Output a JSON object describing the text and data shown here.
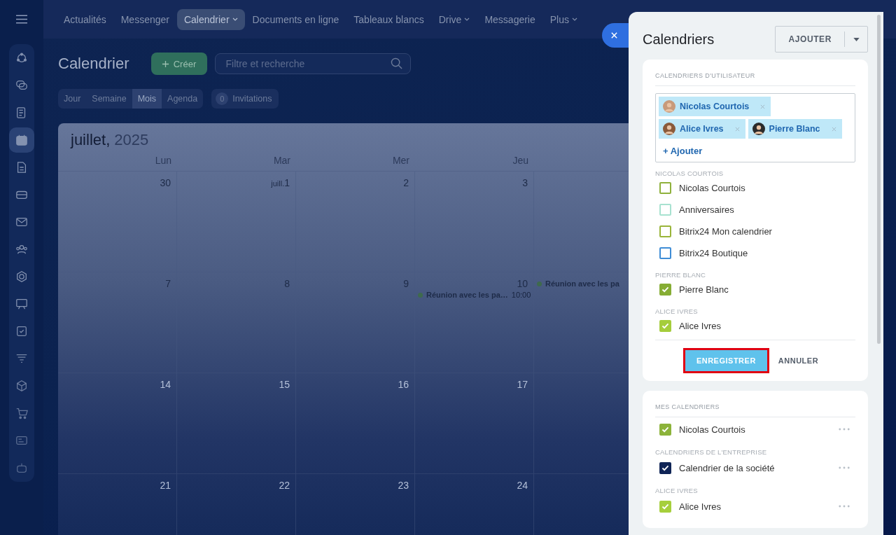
{
  "nav": {
    "items": [
      {
        "label": "Actualités",
        "selected": false,
        "dropdown": false
      },
      {
        "label": "Messenger",
        "selected": false,
        "dropdown": false
      },
      {
        "label": "Calendrier",
        "selected": true,
        "dropdown": true
      },
      {
        "label": "Documents en ligne",
        "selected": false,
        "dropdown": false
      },
      {
        "label": "Tableaux blancs",
        "selected": false,
        "dropdown": false
      },
      {
        "label": "Drive",
        "selected": false,
        "dropdown": true
      },
      {
        "label": "Messagerie",
        "selected": false,
        "dropdown": false
      },
      {
        "label": "Plus",
        "selected": false,
        "dropdown": true
      }
    ]
  },
  "sidebar": {
    "items": [
      {
        "selected": false
      },
      {
        "selected": false
      },
      {
        "selected": false
      },
      {
        "selected": true
      },
      {
        "selected": false
      },
      {
        "selected": false
      },
      {
        "selected": false
      },
      {
        "selected": false
      },
      {
        "selected": false
      },
      {
        "selected": false
      },
      {
        "selected": false
      },
      {
        "selected": false
      },
      {
        "selected": false
      },
      {
        "selected": false
      },
      {
        "selected": false
      },
      {
        "selected": false
      }
    ]
  },
  "header": {
    "title": "Calendrier",
    "create_button": "Créer",
    "search": {
      "placeholder": "Filtre et recherche"
    }
  },
  "views": [
    {
      "label": "Jour",
      "selected": false
    },
    {
      "label": "Semaine",
      "selected": false
    },
    {
      "label": "Mois",
      "selected": true
    },
    {
      "label": "Agenda",
      "selected": false
    }
  ],
  "invitations": {
    "count": "0",
    "label": "Invitations"
  },
  "calendar": {
    "month": "juillet,",
    "year": "2025",
    "weekdays": [
      "Lun",
      "Mar",
      "Mer",
      "Jeu"
    ],
    "weeks": [
      {
        "days": [
          {
            "label": "30"
          },
          {
            "prefix": "juill.",
            "label": "1"
          },
          {
            "label": "2"
          },
          {
            "label": "3"
          }
        ]
      },
      {
        "days": [
          {
            "label": "7"
          },
          {
            "label": "8"
          },
          {
            "label": "9"
          },
          {
            "label": "10",
            "events": [
              {
                "title": "Réunion avec les pa…",
                "time": "10:00"
              }
            ]
          },
          {
            "events": [
              {
                "title": "Réunion avec les pa"
              }
            ]
          }
        ]
      },
      {
        "days": [
          {
            "label": "14"
          },
          {
            "label": "15"
          },
          {
            "label": "16"
          },
          {
            "label": "17"
          }
        ]
      },
      {
        "days": [
          {
            "label": "21"
          },
          {
            "label": "22"
          },
          {
            "label": "23"
          },
          {
            "label": "24"
          }
        ]
      }
    ]
  },
  "panel": {
    "title": "Calendriers",
    "add_button": "AJOUTER",
    "user_card": {
      "heading": "CALENDRIERS D'UTILISATEUR",
      "tags": [
        {
          "name": "Nicolas Courtois"
        },
        {
          "name": "Alice Ivres"
        },
        {
          "name": "Pierre Blanc"
        }
      ],
      "add_link": "+ Ajouter",
      "groups": [
        {
          "heading": "NICOLAS COURTOIS",
          "items": [
            {
              "label": "Nicolas Courtois",
              "checked": false,
              "color": "#8fb13c"
            },
            {
              "label": "Anniversaires",
              "checked": false,
              "color": "#a8e2d0"
            },
            {
              "label": "Bitrix24 Mon calendrier",
              "checked": false,
              "color": "#9ab53a"
            },
            {
              "label": "Bitrix24 Boutique",
              "checked": false,
              "color": "#3f8dd6"
            }
          ]
        },
        {
          "heading": "PIERRE BLANC",
          "items": [
            {
              "label": "Pierre Blanc",
              "checked": true,
              "color": "#86ad34"
            }
          ]
        },
        {
          "heading": "ALICE IVRES",
          "items": [
            {
              "label": "Alice Ivres",
              "checked": true,
              "color": "#a5cd3c"
            }
          ]
        }
      ],
      "save_button": {
        "label": "ENREGISTRER",
        "highlighted": true
      },
      "cancel_button": "ANNULER"
    },
    "my_card": {
      "heading": "MES CALENDRIERS",
      "groups": [
        {
          "items": [
            {
              "label": "Nicolas Courtois",
              "checked": true,
              "color": "#8cb33a"
            }
          ]
        },
        {
          "heading": "CALENDRIERS DE L'ENTREPRISE",
          "items": [
            {
              "label": "Calendrier de la société",
              "checked": true,
              "color": "#0f2456"
            }
          ]
        },
        {
          "heading": "ALICE IVRES",
          "items": [
            {
              "label": "Alice Ivres",
              "checked": true,
              "color": "#a6cf3c"
            }
          ]
        }
      ]
    }
  }
}
